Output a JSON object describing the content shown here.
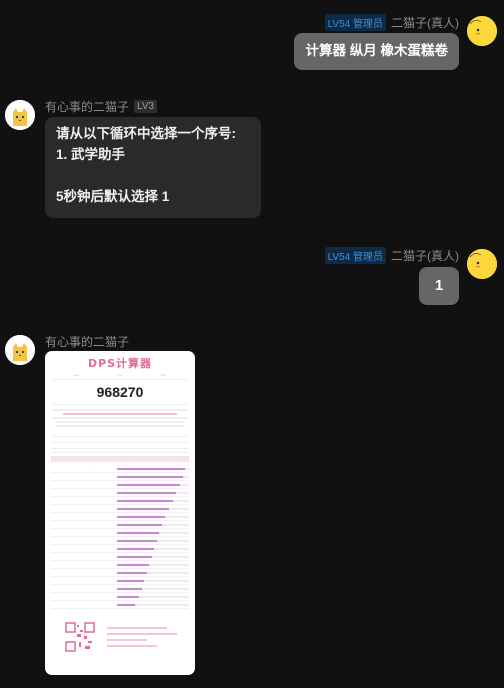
{
  "messages": [
    {
      "sender": "二猫子(真人)",
      "level_badge": "LV54 管理员",
      "text": "计算器 纵月 橡木蛋糕卷"
    },
    {
      "sender": "有心事的二猫子",
      "level_badge": "LV3",
      "text": "请从以下循环中选择一个序号:\n1. 武学助手\n\n5秒钟后默认选择 1"
    },
    {
      "sender": "二猫子(真人)",
      "level_badge": "LV54 管理员",
      "text": "1"
    },
    {
      "sender": "有心事的二猫子",
      "image": {
        "title": "DPS计算器",
        "big_number": "968270"
      }
    }
  ],
  "colors": {
    "background": "#111111",
    "outgoing_bubble": "#666666",
    "incoming_bubble": "#2a2a2a",
    "admin_badge": "#3b8fd9"
  },
  "image_bars": [
    0.95,
    0.92,
    0.88,
    0.82,
    0.78,
    0.72,
    0.66,
    0.62,
    0.58,
    0.55,
    0.52,
    0.48,
    0.45,
    0.42,
    0.38,
    0.35,
    0.3,
    0.25
  ]
}
